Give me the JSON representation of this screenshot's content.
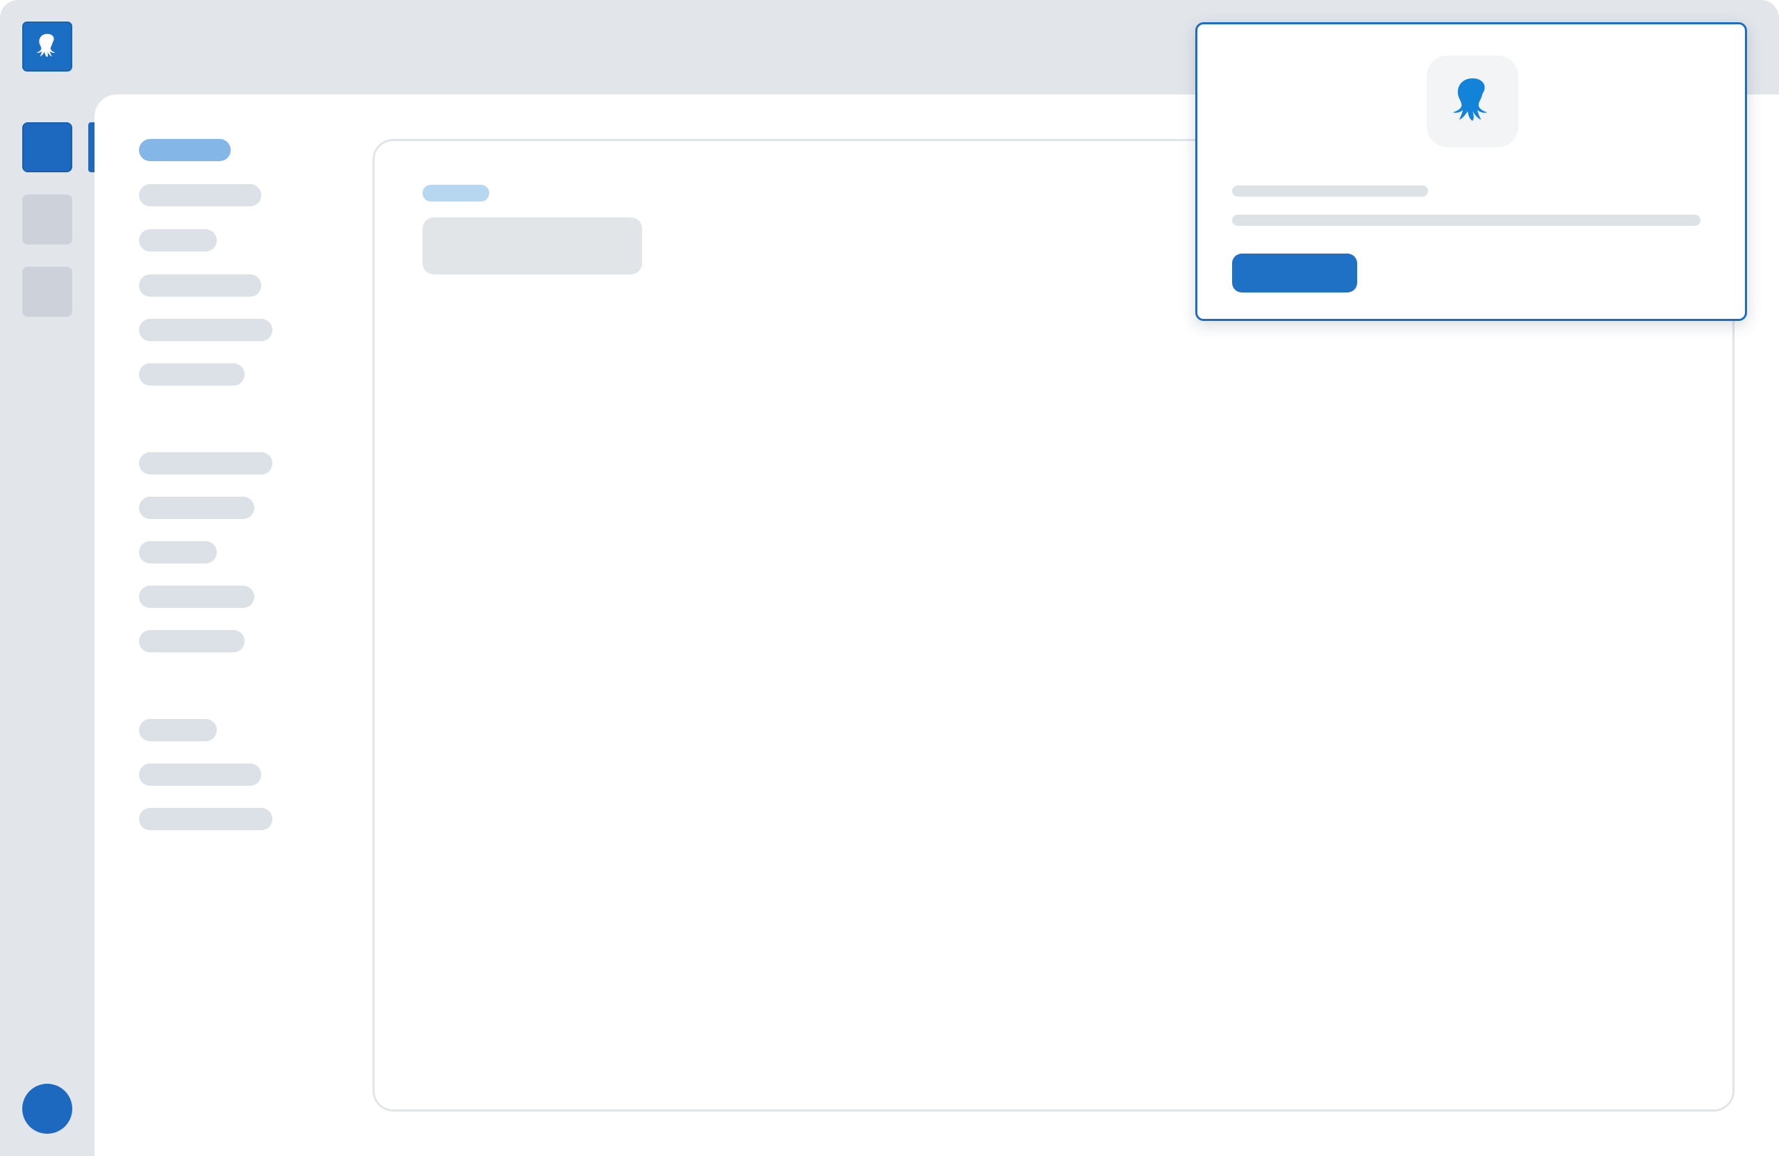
{
  "app": {
    "name": "",
    "colors": {
      "accent": "#1e6cc2",
      "rail_background": "#e2e6eb",
      "placeholder": "#dbe1e7",
      "active_placeholder": "#84b6e8"
    }
  },
  "rail": {
    "logo_icon": "octopus-icon",
    "items": [
      {
        "state": "active"
      },
      {
        "state": "inactive"
      },
      {
        "state": "inactive"
      }
    ],
    "avatar": "user-avatar"
  },
  "sidebar": {
    "groups": [
      {
        "items": [
          {
            "state": "active"
          },
          {},
          {},
          {},
          {},
          {}
        ]
      },
      {
        "items": [
          {},
          {},
          {},
          {},
          {}
        ]
      },
      {
        "items": [
          {},
          {},
          {}
        ]
      }
    ]
  },
  "content": {
    "breadcrumb": "",
    "title": ""
  },
  "popup": {
    "logo_icon": "octopus-icon",
    "title": "",
    "body": "",
    "button_label": ""
  }
}
